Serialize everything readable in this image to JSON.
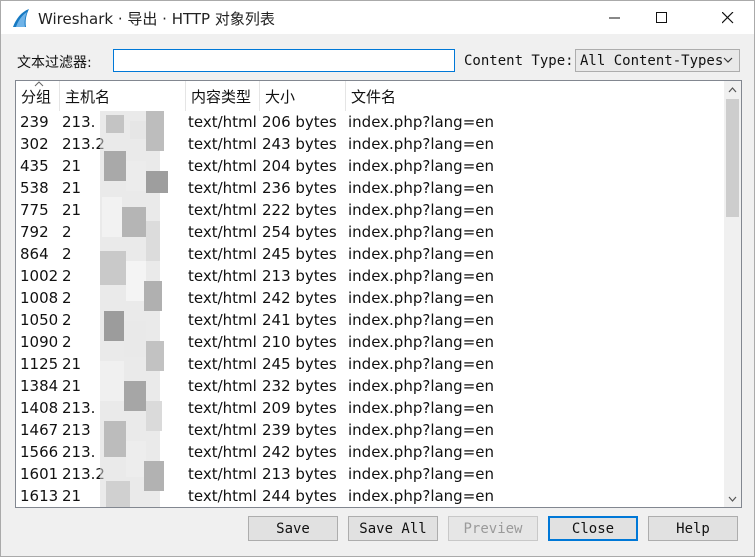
{
  "window": {
    "title": "Wireshark · 导出 · HTTP 对象列表",
    "icon": "wireshark-fin-icon",
    "controls": [
      "minimize-icon",
      "maximize-icon",
      "close-icon"
    ]
  },
  "filter": {
    "label": "文本过滤器:",
    "value": "",
    "placeholder": ""
  },
  "content_type": {
    "label": "Content Type:",
    "selected": "All Content-Types"
  },
  "table": {
    "columns": [
      "分组",
      "主机名",
      "内容类型",
      "大小",
      "文件名"
    ],
    "sorted_column": "分组",
    "rows": [
      {
        "packet": "239",
        "host": "213.",
        "type": "text/html",
        "size": "206 bytes",
        "file": "index.php?lang=en"
      },
      {
        "packet": "302",
        "host": "213.2",
        "type": "text/html",
        "size": "243 bytes",
        "file": "index.php?lang=en"
      },
      {
        "packet": "435",
        "host": "21",
        "type": "text/html",
        "size": "204 bytes",
        "file": "index.php?lang=en"
      },
      {
        "packet": "538",
        "host": "21",
        "type": "text/html",
        "size": "236 bytes",
        "file": "index.php?lang=en"
      },
      {
        "packet": "775",
        "host": "21",
        "type": "text/html",
        "size": "222 bytes",
        "file": "index.php?lang=en"
      },
      {
        "packet": "792",
        "host": "2",
        "type": "text/html",
        "size": "254 bytes",
        "file": "index.php?lang=en"
      },
      {
        "packet": "864",
        "host": "2",
        "type": "text/html",
        "size": "245 bytes",
        "file": "index.php?lang=en"
      },
      {
        "packet": "1002",
        "host": "2",
        "type": "text/html",
        "size": "213 bytes",
        "file": "index.php?lang=en"
      },
      {
        "packet": "1008",
        "host": "2",
        "type": "text/html",
        "size": "242 bytes",
        "file": "index.php?lang=en"
      },
      {
        "packet": "1050",
        "host": "2",
        "type": "text/html",
        "size": "241 bytes",
        "file": "index.php?lang=en"
      },
      {
        "packet": "1090",
        "host": "2",
        "type": "text/html",
        "size": "210 bytes",
        "file": "index.php?lang=en"
      },
      {
        "packet": "1125",
        "host": "21",
        "type": "text/html",
        "size": "245 bytes",
        "file": "index.php?lang=en"
      },
      {
        "packet": "1384",
        "host": "21",
        "type": "text/html",
        "size": "232 bytes",
        "file": "index.php?lang=en"
      },
      {
        "packet": "1408",
        "host": "213.",
        "type": "text/html",
        "size": "209 bytes",
        "file": "index.php?lang=en"
      },
      {
        "packet": "1467",
        "host": "213",
        "type": "text/html",
        "size": "239 bytes",
        "file": "index.php?lang=en"
      },
      {
        "packet": "1566",
        "host": "213.",
        "type": "text/html",
        "size": "242 bytes",
        "file": "index.php?lang=en"
      },
      {
        "packet": "1601",
        "host": "213.2",
        "type": "text/html",
        "size": "213 bytes",
        "file": "index.php?lang=en"
      },
      {
        "packet": "1613",
        "host": "21",
        "type": "text/html",
        "size": "244 bytes",
        "file": "index.php?lang=en"
      }
    ]
  },
  "buttons": {
    "save": "Save",
    "save_all": "Save All",
    "preview": "Preview",
    "close": "Close",
    "help": "Help"
  }
}
